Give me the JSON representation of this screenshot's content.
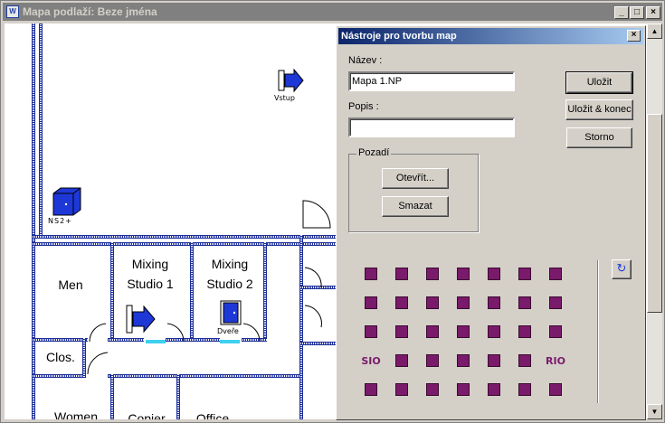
{
  "window": {
    "title": "Mapa podlaží: Beze jména",
    "app_icon": "app-icon",
    "buttons": [
      "_",
      "□",
      "×"
    ]
  },
  "map": {
    "rooms": [
      {
        "label": "Men"
      },
      {
        "label": "Mixing\nStudio 1"
      },
      {
        "label": "Mixing\nStudio 2"
      },
      {
        "label": "Clos."
      },
      {
        "label": "Women"
      },
      {
        "label": "Copier"
      },
      {
        "label": "Office"
      }
    ],
    "objects": [
      {
        "label": "Vstup",
        "icon": "entrance-icon"
      },
      {
        "label": "NS2+",
        "icon": "cube-icon"
      },
      {
        "label": "Dveře",
        "icon": "door-icon"
      }
    ]
  },
  "panel": {
    "title": "Nástroje pro tvorbu map",
    "name_label": "Název :",
    "name_value": "Mapa 1.NP",
    "desc_label": "Popis :",
    "desc_value": "",
    "save_label": "Uložit",
    "save_close_label": "Uložit & konec",
    "cancel_label": "Storno",
    "background_group": "Pozadí",
    "open_label": "Otevřít...",
    "delete_label": "Smazat",
    "tools": [
      "bell-icon",
      "entrance-icon",
      "door-icon",
      "arch-door-icon",
      "cube-icon",
      "dome-camera-icon",
      "box-camera-icon",
      "sensor-icon",
      "panel-icon",
      "arrow-right-icon",
      "fence-icon",
      "keypad-icon",
      "monitor-icon",
      "camera-icon",
      "window-icon",
      "gate-icon",
      "display-icon",
      "display-red-icon",
      "stack-icon",
      "document-icon",
      "smoke-icon",
      "SIO",
      "module-icon",
      "rack-icon",
      "network-icon",
      "printer-icon",
      "calculator-icon",
      "RIO",
      "siren-icon",
      "arrow-left-icon",
      "arrow-curve-icon",
      "arrow-both-icon",
      "reader-icon",
      "arrow-fwd-icon",
      "card-icon"
    ],
    "refresh_icon": "refresh-icon"
  }
}
